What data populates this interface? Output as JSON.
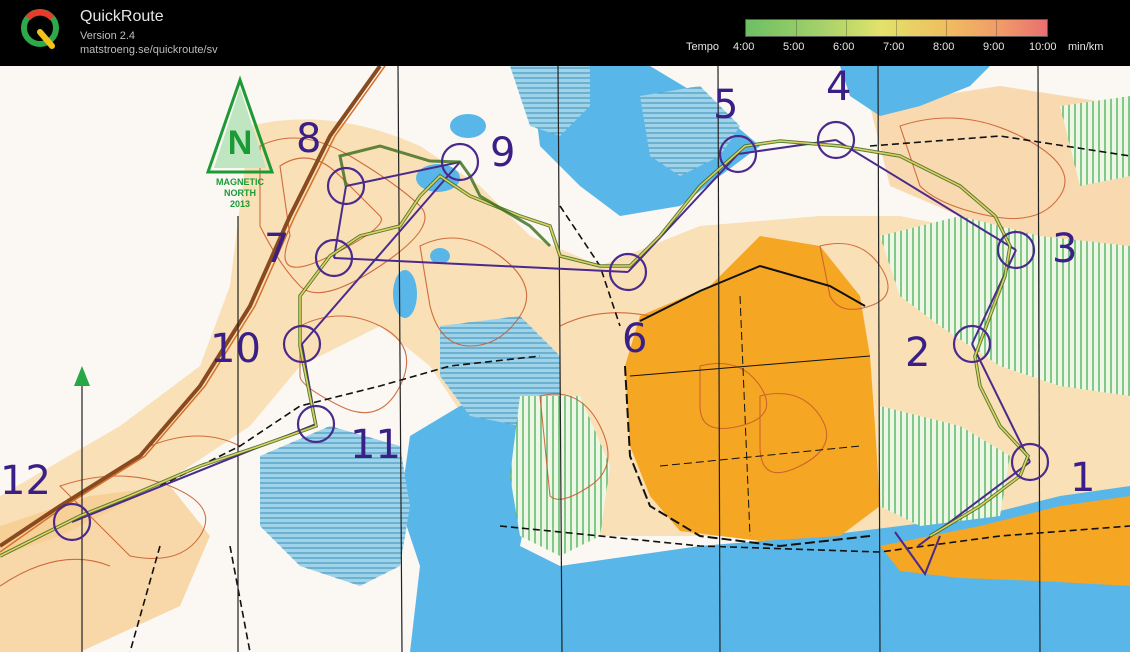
{
  "app": {
    "title": "QuickRoute",
    "version": "Version 2.4",
    "url": "matstroeng.se/quickroute/sv"
  },
  "legend": {
    "label": "Tempo",
    "ticks": [
      "4:00",
      "5:00",
      "6:00",
      "7:00",
      "8:00",
      "9:00",
      "10:00"
    ],
    "unit": "min/km",
    "gradient_colors": [
      "#6dbf63",
      "#a4d16a",
      "#e2e36a",
      "#f0c060",
      "#f09a68",
      "#e97070"
    ]
  },
  "map": {
    "north_arrow": {
      "letter": "N",
      "line1": "MAGNETIC",
      "line2": "NORTH",
      "line3": "2013"
    },
    "controls": [
      "1",
      "2",
      "3",
      "4",
      "5",
      "6",
      "7",
      "8",
      "9",
      "10",
      "11",
      "12"
    ],
    "colors": {
      "course": "#4a2a8c",
      "water": "#59b6e8",
      "open_land": "#f5a623",
      "rough_open": "#f9d9a6",
      "contour": "#c8592a",
      "marsh": "#3aa0c9",
      "vegetation": "#39a84a",
      "route": "#e0d060"
    }
  }
}
